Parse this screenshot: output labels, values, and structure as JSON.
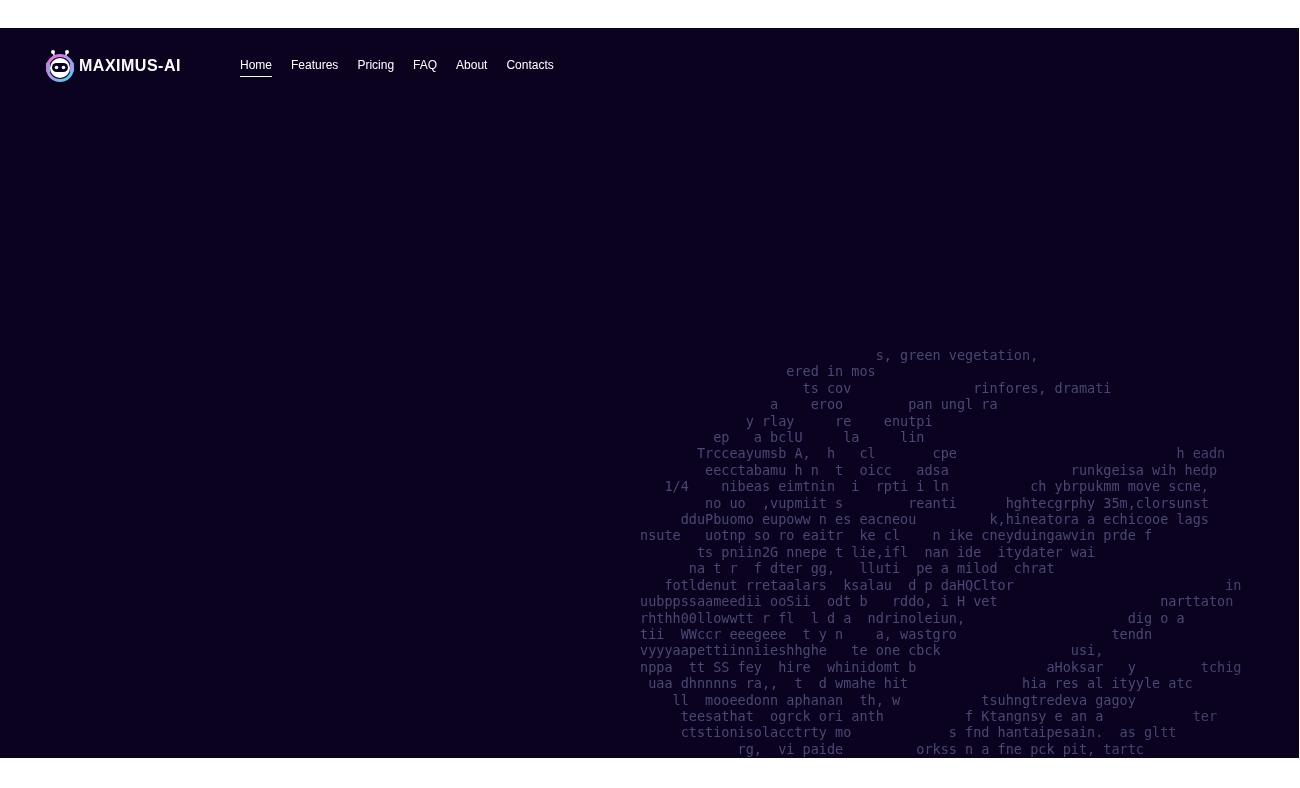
{
  "header": {
    "logo_text": "MAXIMUS-AI",
    "nav": [
      {
        "label": "Home",
        "selected": true
      },
      {
        "label": "Features",
        "selected": false
      },
      {
        "label": "Pricing",
        "selected": false
      },
      {
        "label": "FAQ",
        "selected": false
      },
      {
        "label": "About",
        "selected": false
      },
      {
        "label": "Contacts",
        "selected": false
      }
    ]
  },
  "text_art": {
    "lines": [
      "                             s, green vegetation,",
      "                  ered in mos",
      "                    ts cov               rinfores, dramati",
      "                a    eroo        pan ungl ra",
      "             y rlay     re    enutpi",
      "         ep   a bclU     la     lin",
      "       Trcceayumsb A,  h   cl       cpe                           h eadn",
      "        eecctabamu h n  t  oicc   adsa               runkgeisa wih hedp",
      "   1/4    nibeas eimtnin  i  rpti i ln          ch ybrpukmm move scne,",
      "        no uo  ,vupmiit s        reanti      hghtecgrphy 35m,clorsunst",
      "     dduPbuomo eupoww n es eacneou         k,hineatora a echicooe lags",
      "nsute   uotnp so ro eaitr  ke cl    n ike cneyduingawvin prde f",
      "       ts pniin2G nnepe t lie,ifl  nan ide  itydater wai",
      "      na t r  f dter gg,   lluti  pe a milod  chrat",
      "   fotldenut rretaalars  ksalau  d p daHQCltor                          in",
      "uubppssaameedii ooSii  odt b   rddo, i H vet                    narttaton",
      "rhthh00llowwtt r fl  l d a  ndrinoleiun,                    dig o a",
      "tii  WWccr eeegeee  t y n    a, wastgro                   tendn",
      "vyyyaapettiinniieshhghe   te one cbck                usi,",
      "nppa  tt SS fey  hire  whinidomt b                aHoksar   y        tchig",
      " uaa dhnnnns ra,,  t  d wmahe hit              hia res al ityyle atc",
      "    ll  mooeedonn aphanan  th, w          tsuhngtredeva gagoy",
      "     teesathat  ogrck ori anth          f Ktangnsy e an a           ter",
      "     ctstionisolacctrty mo            s fnd hantaipesain.  as gltt",
      "            rg,  vi paide         orkss n a fne pck pit, tartc"
    ]
  }
}
